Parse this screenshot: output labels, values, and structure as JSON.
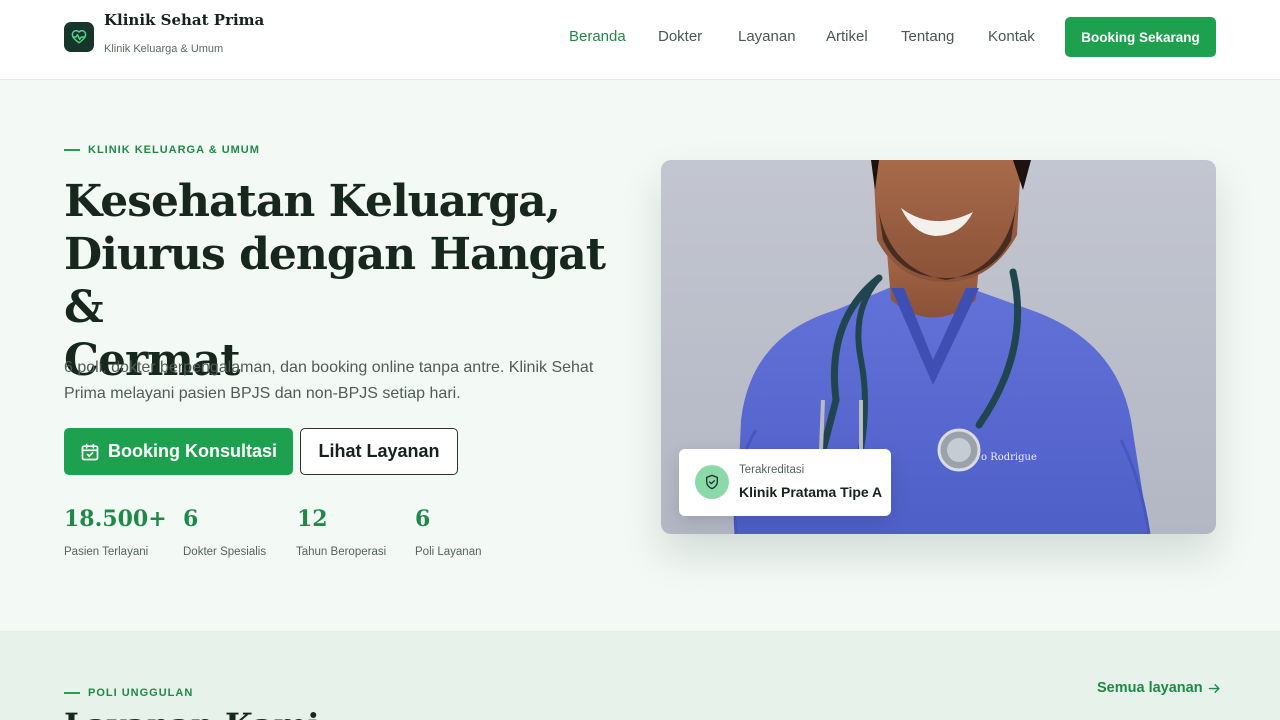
{
  "brand": {
    "name": "Klinik Sehat Prima",
    "tagline": "Klinik Keluarga & Umum"
  },
  "nav": {
    "items": [
      {
        "label": "Beranda",
        "active": true
      },
      {
        "label": "Dokter"
      },
      {
        "label": "Layanan"
      },
      {
        "label": "Artikel"
      },
      {
        "label": "Tentang"
      },
      {
        "label": "Kontak"
      }
    ],
    "cta": "Booking Sekarang"
  },
  "hero": {
    "eyebrow": "KLINIK KELUARGA & UMUM",
    "title_line1": "Kesehatan Keluarga,",
    "title_line2": "Diurus dengan Hangat &",
    "title_line3": "Cermat",
    "description": "6 poli, dokter berpengalaman, dan booking online tanpa antre. Klinik Sehat Prima melayani pasien BPJS dan non-BPJS setiap hari.",
    "primary_cta": "Booking Konsultasi",
    "secondary_cta": "Lihat Layanan",
    "stats": [
      {
        "value": "18.500+",
        "label": "Pasien Terlayani"
      },
      {
        "value": "6",
        "label": "Dokter Spesialis"
      },
      {
        "value": "12",
        "label": "Tahun Beroperasi"
      },
      {
        "value": "6",
        "label": "Poli Layanan"
      }
    ],
    "badge": {
      "small": "Terakreditasi",
      "big": "Klinik Pratama Tipe A"
    },
    "image_name_tag": "o Rodrigue"
  },
  "section2": {
    "eyebrow": "POLI UNGGULAN",
    "title": "Layanan Kami",
    "link": "Semua layanan"
  },
  "colors": {
    "accent": "#1ea14f",
    "accent_text": "#1f8a47",
    "background": "#f3f9f5",
    "dark": "#17271e"
  },
  "icons": {
    "logo": "heart-pulse-icon",
    "calendar": "calendar-check-icon",
    "shield": "shield-check-icon",
    "arrow": "arrow-right-icon"
  }
}
